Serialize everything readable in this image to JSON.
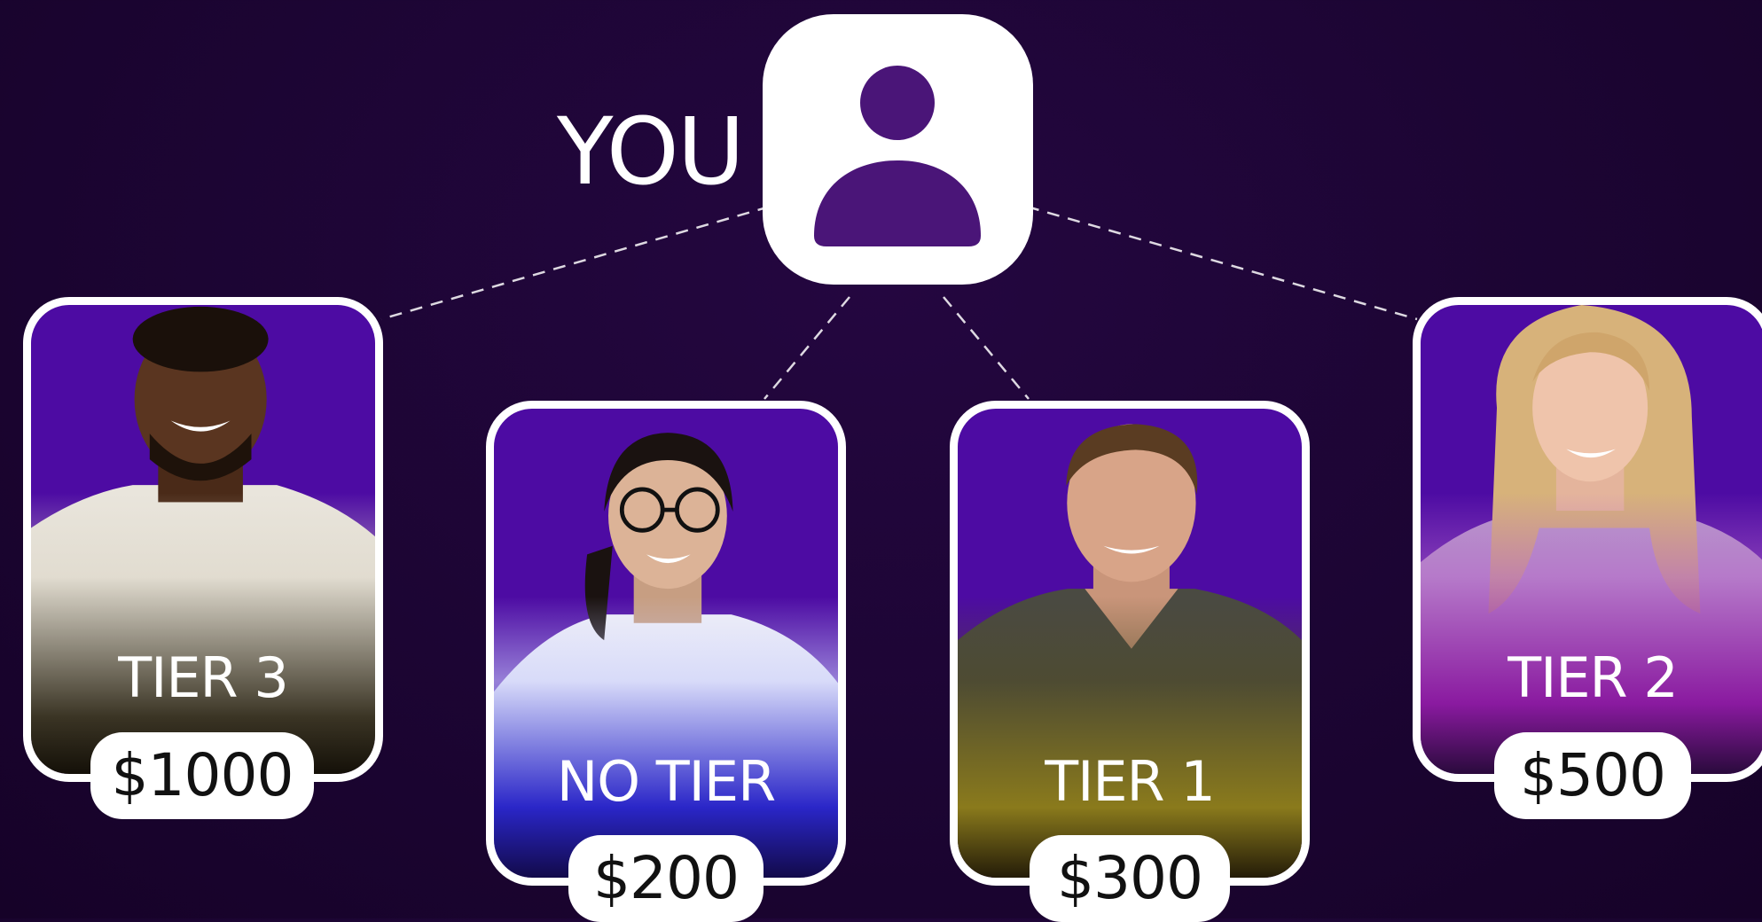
{
  "you": {
    "label": "YOU",
    "icon": "user-icon"
  },
  "colors": {
    "background": "#1c0533",
    "card_bg": "#4d0ba3",
    "accent_purple": "#4a1578",
    "white": "#ffffff"
  },
  "tiers": [
    {
      "key": "tier3",
      "label": "TIER 3",
      "price": "$1000",
      "fade_color": "#3a3424"
    },
    {
      "key": "notier",
      "label": "NO TIER",
      "price": "$200",
      "fade_color": "#2a26c8"
    },
    {
      "key": "tier1",
      "label": "TIER 1",
      "price": "$300",
      "fade_color": "#8a7a1c"
    },
    {
      "key": "tier2",
      "label": "TIER 2",
      "price": "$500",
      "fade_color": "#8a1aa0"
    }
  ]
}
